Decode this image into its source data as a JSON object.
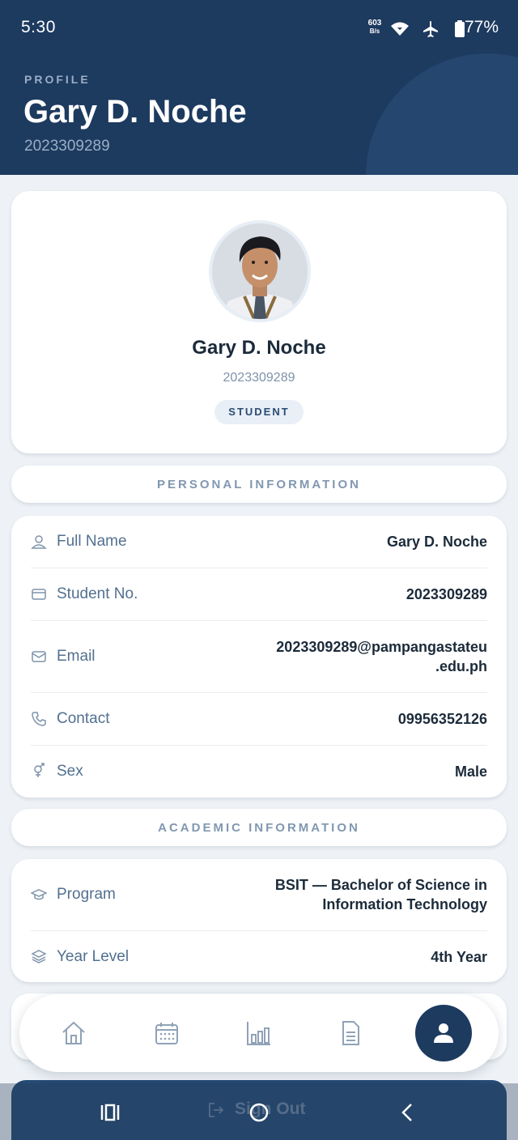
{
  "status_bar": {
    "time": "5:30",
    "net_speed_top": "603",
    "net_speed_bottom": "B/s",
    "battery": "77%"
  },
  "header": {
    "eyebrow": "PROFILE",
    "name": "Gary D. Noche",
    "student_id": "2023309289"
  },
  "profile_card": {
    "name": "Gary D. Noche",
    "student_id": "2023309289",
    "role": "STUDENT"
  },
  "personal": {
    "title": "PERSONAL INFORMATION",
    "rows": [
      {
        "icon": "user-icon",
        "label": "Full Name",
        "value": "Gary D. Noche"
      },
      {
        "icon": "id-card-icon",
        "label": "Student No.",
        "value": "2023309289"
      },
      {
        "icon": "mail-icon",
        "label": "Email",
        "value_line1": "2023309289@pampangastateu",
        "value_line2": ".edu.ph"
      },
      {
        "icon": "phone-icon",
        "label": "Contact",
        "value": "09956352126"
      },
      {
        "icon": "gender-icon",
        "label": "Sex",
        "value": "Male"
      }
    ]
  },
  "academic": {
    "title": "ACADEMIC INFORMATION",
    "rows": [
      {
        "icon": "graduation-cap-icon",
        "label": "Program",
        "value_line1": "BSIT — Bachelor of Science in",
        "value_line2": "Information Technology"
      },
      {
        "icon": "layers-icon",
        "label": "Year Level",
        "value": "4th Year"
      }
    ]
  },
  "nav": {
    "items": [
      "home-icon",
      "calendar-icon",
      "bar-chart-icon",
      "document-icon",
      "profile-icon"
    ],
    "active": "profile-icon"
  },
  "signout": {
    "label": "Sign Out"
  },
  "colors": {
    "primary": "#1d3a5f",
    "background": "#eef2f6",
    "label": "#52708f",
    "muted": "#8197b0"
  }
}
